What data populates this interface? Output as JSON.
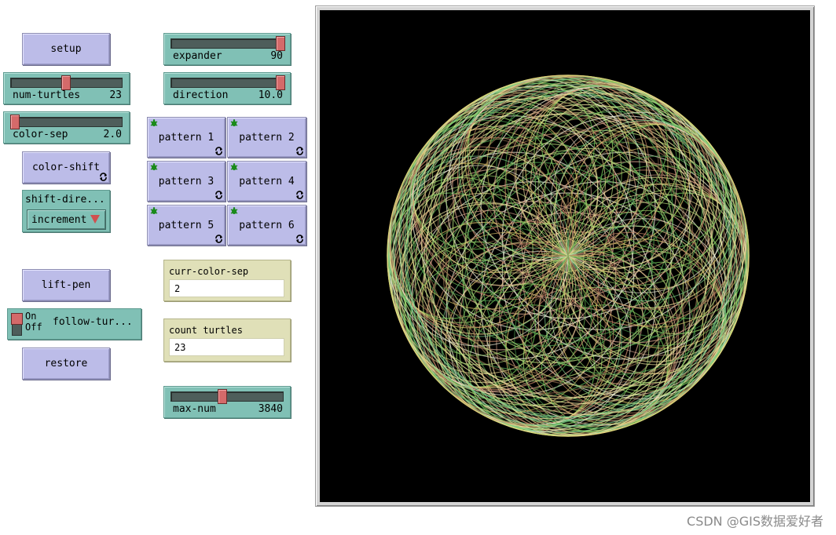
{
  "buttons": {
    "setup": "setup",
    "color_shift": "color-shift",
    "lift_pen": "lift-pen",
    "restore": "restore",
    "pattern_1": "pattern 1",
    "pattern_2": "pattern 2",
    "pattern_3": "pattern 3",
    "pattern_4": "pattern 4",
    "pattern_5": "pattern 5",
    "pattern_6": "pattern 6"
  },
  "sliders": {
    "num_turtles": {
      "name": "num-turtles",
      "value": "23",
      "fraction": 0.49
    },
    "color_sep": {
      "name": "color-sep",
      "value": "2.0",
      "fraction": 0.0
    },
    "expander": {
      "name": "expander",
      "value": "90",
      "fraction": 1.0
    },
    "direction": {
      "name": "direction",
      "value": "10.0",
      "fraction": 1.0
    },
    "max_num": {
      "name": "max-num",
      "value": "3840",
      "fraction": 0.45
    }
  },
  "chooser": {
    "name": "shift-dire...",
    "value": "increment"
  },
  "switch": {
    "on": "On",
    "off": "Off",
    "name": "follow-tur...",
    "state": "on"
  },
  "monitors": {
    "curr_color_sep": {
      "name": "curr-color-sep",
      "value": "2"
    },
    "count_turtles": {
      "name": "count turtles",
      "value": "23"
    }
  },
  "view": {
    "background": "#000000",
    "turtle_count": 23
  },
  "watermark": "CSDN @GIS数据爱好者"
}
